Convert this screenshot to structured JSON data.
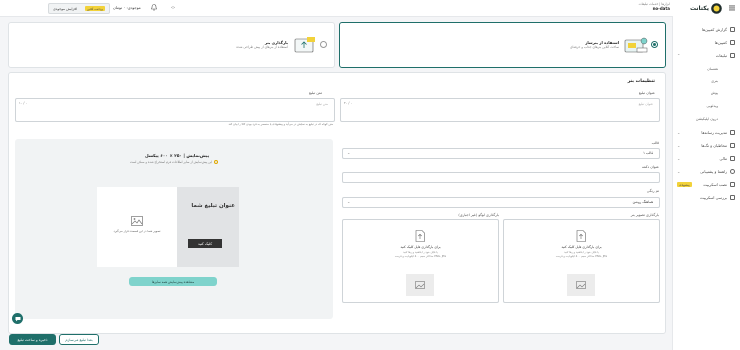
{
  "header": {
    "brand": "no-data",
    "brand_sub": "ابزارها | خدمات تبلیغات",
    "balance_label": "موجودی: ۰ تومان",
    "topup_label": "افزایش موجودی",
    "topup_badge": "پرداخت آنلاین",
    "logo_text": "یکتانت"
  },
  "sidebar": {
    "items": [
      {
        "label": "گزارش کمپین‌ها"
      },
      {
        "label": "کمپین‌ها"
      },
      {
        "label": "تبلیغات"
      },
      {
        "label": "مدیریت رسانه‌ها"
      },
      {
        "label": "مخاطبان و تگ‌ها"
      },
      {
        "label": "مالی"
      },
      {
        "label": "راهنما و پشتیبانی"
      },
      {
        "label": "نصب اسکریپت",
        "badge": "پیشنهادی"
      },
      {
        "label": "بررسی اسکریپت"
      }
    ],
    "subitems": [
      "همسان",
      "بنری",
      "پوش",
      "ویدئویی",
      "درون اپلیکیشن"
    ]
  },
  "method": {
    "option1_title": "استفاده از بنرساز",
    "option1_desc": "ساخت آنلاین بنرهای جذاب و حرفه‌ای",
    "option2_title": "بارگذاری بنر",
    "option2_desc": "استفاده از بنرهای از پیش طراحی شده"
  },
  "settings": {
    "title": "تنظیمات بنر",
    "ad_title_label": "عنوان تبلیغ",
    "ad_title_placeholder": "عنوان تبلیغ",
    "ad_title_counter": "۴۰ / ۰",
    "ad_text_label": "متن تبلیغ",
    "ad_text_placeholder": "متن تبلیغ",
    "ad_text_counter": "۱۰ / ۰",
    "ad_text_hint": "متن کوتاه که در تبلیغ به نمایش در می‌آید و پیشنهادی یا منحصر به فرد بودن کالا را بیان کند",
    "template_label": "قالب",
    "template_value": "قالب ۱",
    "button_text_label": "عنوان دکمه",
    "button_text_value": "",
    "theme_label": "تم رنگی",
    "theme_value": "هماهنگ روشن",
    "image_label": "بارگذاری تصویر بنر",
    "logo_label": "بارگذاری لوگو (غیر اجباری)",
    "upload_title": "برای بارگذاری فایل کلیک کنید",
    "upload_hint": "یا فایل خود را بکشید و رها کنید",
    "upload_formats": "حداکثر حجم ۵۰۰ کیلوبایت و فرمت PNG, JPG"
  },
  "preview": {
    "title": "پیش‌نمایش | ۲۵۰ × ۶۰۰ پیکسل",
    "note": "این پیش‌نمایش از سایر اطلاعات فرم استخراج شده و ممکن است",
    "banner_title": "عنوان تبلیغ شما",
    "banner_cta": "کلیک کنید",
    "banner_image_hint": "تصویر شما در این قسمت قرار می‌گیرد",
    "all_sizes_button": "مشاهده پیش‌نمایش همه سایزها"
  },
  "footer": {
    "save_button": "ذخیره و ساخت تبلیغ",
    "new_ad_button": "بعدا تبلیغ می‌سازم"
  },
  "colors": {
    "primary": "#1f6f6a",
    "accent": "#7fd3cc",
    "badge": "#f2d23a"
  }
}
